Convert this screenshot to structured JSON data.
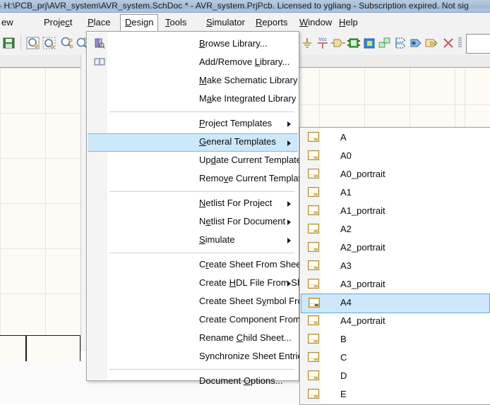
{
  "window": {
    "title": "- H:\\PCB_prj\\AVR_system\\AVR_system.SchDoc * - AVR_system.PrjPcb. Licensed to ygliang - Subscription expired. Not sig"
  },
  "menubar": {
    "items": [
      {
        "label": "ew",
        "accel": "",
        "name": "menu-view",
        "active": false
      },
      {
        "label": "Project",
        "accel": "c",
        "name": "menu-project",
        "active": false
      },
      {
        "label": "Place",
        "accel": "P",
        "name": "menu-place",
        "active": false
      },
      {
        "label": "Design",
        "accel": "D",
        "name": "menu-design",
        "active": true
      },
      {
        "label": "Tools",
        "accel": "T",
        "name": "menu-tools",
        "active": false
      },
      {
        "label": "Simulator",
        "accel": "S",
        "name": "menu-simulator",
        "active": false
      },
      {
        "label": "Reports",
        "accel": "R",
        "name": "menu-reports",
        "active": false
      },
      {
        "label": "Window",
        "accel": "W",
        "name": "menu-window",
        "active": false
      },
      {
        "label": "Help",
        "accel": "H",
        "name": "menu-help",
        "active": false
      }
    ]
  },
  "toolbar": {
    "left_icons": [
      {
        "name": "save-icon"
      },
      {
        "name": "zoom-document-icon"
      },
      {
        "name": "zoom-area-icon"
      },
      {
        "name": "zoom-selected-icon"
      },
      {
        "name": "zoom-filter-icon"
      },
      {
        "name": "toolbar-dropdown-arrow-icon"
      }
    ],
    "right_icons": [
      {
        "name": "gnd-power-port-icon"
      },
      {
        "name": "vcc-power-port-icon"
      },
      {
        "name": "place-part-icon"
      },
      {
        "name": "place-sheet-symbol-icon"
      },
      {
        "name": "place-sheet-entry-icon"
      },
      {
        "name": "place-device-sheet-icon"
      },
      {
        "name": "place-port-icon"
      },
      {
        "name": "place-net-label-icon"
      },
      {
        "name": "place-bus-entry-icon"
      },
      {
        "name": "place-no-erc-icon"
      },
      {
        "name": "grid-selector-icon"
      }
    ]
  },
  "design_menu": {
    "items": [
      {
        "label": "Browse Library...",
        "accel": "B",
        "icon": "browse-library-icon",
        "arrow": false,
        "sep_before": false,
        "selected": false
      },
      {
        "label": "Add/Remove Library...",
        "accel": "L",
        "icon": "add-remove-library-icon",
        "arrow": false,
        "sep_before": false,
        "selected": false
      },
      {
        "label": "Make Schematic Library",
        "accel": "M",
        "icon": "",
        "arrow": false,
        "sep_before": false,
        "selected": false
      },
      {
        "label": "Make Integrated Library",
        "accel": "a",
        "icon": "",
        "arrow": false,
        "sep_before": false,
        "selected": false
      },
      {
        "label": "Project Templates",
        "accel": "P",
        "icon": "",
        "arrow": true,
        "sep_before": true,
        "selected": false
      },
      {
        "label": "General Templates",
        "accel": "G",
        "icon": "",
        "arrow": true,
        "sep_before": false,
        "selected": true
      },
      {
        "label": "Update Current Template...",
        "accel": "d",
        "icon": "",
        "arrow": false,
        "sep_before": false,
        "selected": false
      },
      {
        "label": "Remove Current Template...",
        "accel": "v",
        "icon": "",
        "arrow": false,
        "sep_before": false,
        "selected": false
      },
      {
        "label": "Netlist For Project",
        "accel": "N",
        "icon": "",
        "arrow": true,
        "sep_before": true,
        "selected": false
      },
      {
        "label": "Netlist For Document",
        "accel": "e",
        "icon": "",
        "arrow": true,
        "sep_before": false,
        "selected": false
      },
      {
        "label": "Simulate",
        "accel": "S",
        "icon": "",
        "arrow": true,
        "sep_before": false,
        "selected": false
      },
      {
        "label": "Create Sheet From Sheet Symbol",
        "accel": "r",
        "icon": "",
        "arrow": false,
        "sep_before": true,
        "selected": false
      },
      {
        "label": "Create HDL File From Sheet Symbol",
        "accel": "H",
        "icon": "",
        "arrow": true,
        "sep_before": false,
        "selected": false
      },
      {
        "label": "Create Sheet Symbol From Sheet or HDL",
        "accel": "y",
        "icon": "",
        "arrow": false,
        "sep_before": false,
        "selected": false
      },
      {
        "label": "Create Component From Sheet",
        "accel": "",
        "icon": "",
        "arrow": false,
        "sep_before": false,
        "selected": false
      },
      {
        "label": "Rename Child Sheet...",
        "accel": "C",
        "icon": "",
        "arrow": false,
        "sep_before": false,
        "selected": false
      },
      {
        "label": "Synchronize Sheet Entries and Ports",
        "accel": "P",
        "icon": "",
        "arrow": false,
        "sep_before": false,
        "selected": false
      },
      {
        "label": "Document Options...",
        "accel": "O",
        "icon": "",
        "arrow": false,
        "sep_before": true,
        "selected": false
      }
    ]
  },
  "general_templates_submenu": {
    "items": [
      {
        "label": "A",
        "icon": "template-sheet-icon",
        "selected": false
      },
      {
        "label": "A0",
        "icon": "template-sheet-icon",
        "selected": false
      },
      {
        "label": "A0_portrait",
        "icon": "template-sheet-icon",
        "selected": false
      },
      {
        "label": "A1",
        "icon": "template-sheet-icon",
        "selected": false
      },
      {
        "label": "A1_portrait",
        "icon": "template-sheet-icon",
        "selected": false
      },
      {
        "label": "A2",
        "icon": "template-sheet-icon",
        "selected": false
      },
      {
        "label": "A2_portrait",
        "icon": "template-sheet-icon",
        "selected": false
      },
      {
        "label": "A3",
        "icon": "template-sheet-icon",
        "selected": false
      },
      {
        "label": "A3_portrait",
        "icon": "template-sheet-icon",
        "selected": false
      },
      {
        "label": "A4",
        "icon": "template-sheet-icon",
        "selected": true
      },
      {
        "label": "A4_portrait",
        "icon": "template-sheet-icon",
        "selected": false
      },
      {
        "label": "B",
        "icon": "template-sheet-icon",
        "selected": false
      },
      {
        "label": "C",
        "icon": "template-sheet-icon",
        "selected": false
      },
      {
        "label": "D",
        "icon": "template-sheet-icon",
        "selected": false
      },
      {
        "label": "E",
        "icon": "template-sheet-icon",
        "selected": false
      }
    ]
  },
  "colors": {
    "titlebar": "#a9c1da",
    "highlight": "#cde8fb",
    "highlight_border": "#5ea9d8",
    "menu_bg": "#ffffff",
    "gutter": "#f4f4f4",
    "sheet": "#fdfbf4"
  }
}
